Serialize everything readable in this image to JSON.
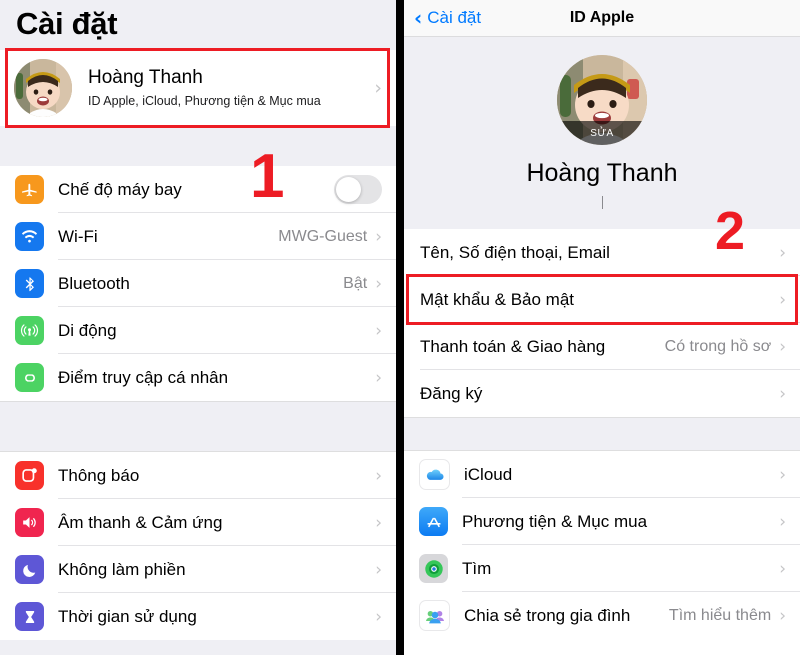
{
  "left_panel": {
    "title": "Cài đặt",
    "profile": {
      "name": "Hoàng Thanh",
      "subtitle": "ID Apple, iCloud, Phương tiện & Mục mua",
      "chevron": "chevron-right-icon"
    },
    "group1": [
      {
        "icon": "airplane-icon",
        "label": "Chế độ máy bay",
        "control": "toggle",
        "toggle_on": false
      },
      {
        "icon": "wifi-icon",
        "label": "Wi-Fi",
        "value": "MWG-Guest",
        "control": "chevron"
      },
      {
        "icon": "bluetooth-icon",
        "label": "Bluetooth",
        "value": "Bật",
        "control": "chevron"
      },
      {
        "icon": "cellular-icon",
        "label": "Di động",
        "value": "",
        "control": "chevron"
      },
      {
        "icon": "hotspot-icon",
        "label": "Điểm truy cập cá nhân",
        "value": "",
        "control": "chevron"
      }
    ],
    "group2": [
      {
        "icon": "notifications-icon",
        "label": "Thông báo",
        "value": "",
        "control": "chevron"
      },
      {
        "icon": "sound-icon",
        "label": "Âm thanh & Cảm ứng",
        "value": "",
        "control": "chevron"
      },
      {
        "icon": "moon-icon",
        "label": "Không làm phiền",
        "value": "",
        "control": "chevron"
      },
      {
        "icon": "hourglass-icon",
        "label": "Thời gian sử dụng",
        "value": "",
        "control": "chevron"
      }
    ]
  },
  "right_panel": {
    "nav": {
      "back_label": "Cài đặt",
      "back_icon": "chevron-left-icon",
      "title": "ID Apple"
    },
    "hero": {
      "edit_label": "SỬA",
      "name": "Hoàng Thanh"
    },
    "group1": [
      {
        "label": "Tên, Số điện thoại, Email",
        "value": "",
        "control": "chevron"
      },
      {
        "label": "Mật khẩu & Bảo mật",
        "value": "",
        "control": "chevron"
      },
      {
        "label": "Thanh toán & Giao hàng",
        "value": "Có trong hồ sơ",
        "control": "chevron"
      },
      {
        "label": "Đăng ký",
        "value": "",
        "control": "chevron"
      }
    ],
    "group2": [
      {
        "icon": "icloud-icon",
        "label": "iCloud",
        "value": "",
        "control": "chevron"
      },
      {
        "icon": "appstore-icon",
        "label": "Phương tiện & Mục mua",
        "value": "",
        "control": "chevron"
      },
      {
        "icon": "findmy-icon",
        "label": "Tìm",
        "value": "",
        "control": "chevron"
      },
      {
        "icon": "family-icon",
        "label": "Chia sẻ trong gia đình",
        "value": "Tìm hiểu thêm",
        "control": "chevron"
      }
    ]
  },
  "annotations": {
    "step1": "1",
    "step2": "2",
    "highlight_color": "#ed1c24"
  }
}
